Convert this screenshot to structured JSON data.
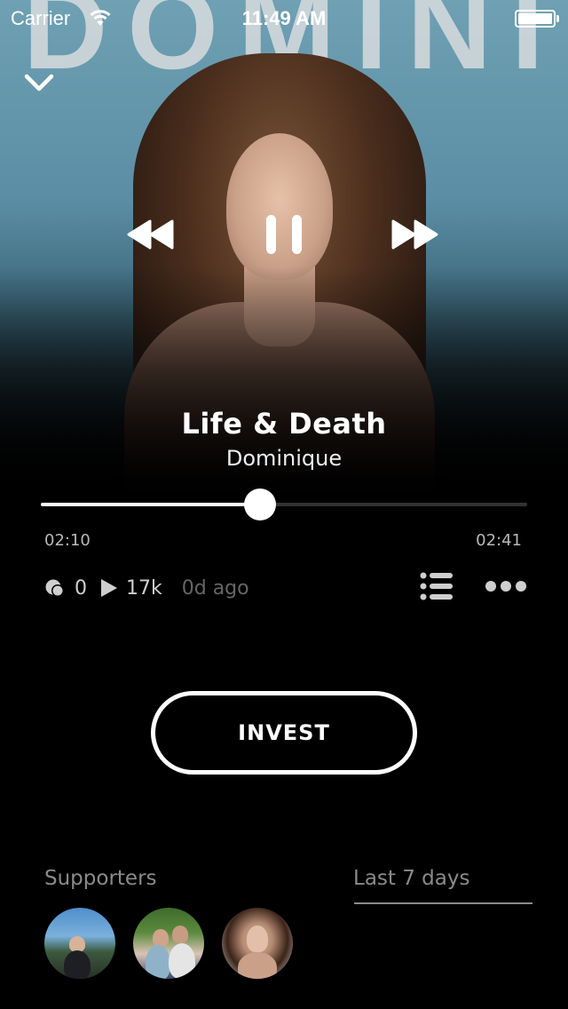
{
  "status_bar": {
    "carrier": "Carrier",
    "time": "11:49 AM"
  },
  "album_art": {
    "lettering": "DOMINIQUE"
  },
  "track": {
    "title": "Life & Death",
    "artist": "Dominique",
    "elapsed": "02:10",
    "duration": "02:41",
    "progress_fraction": 0.45
  },
  "stats": {
    "supporters_count": "0",
    "plays": "17k",
    "age": "0d ago"
  },
  "invest_button": {
    "label": "INVEST"
  },
  "supporters": {
    "label": "Supporters",
    "range": "Last 7 days",
    "avatars": [
      "supporter-1",
      "supporter-2",
      "supporter-3"
    ]
  },
  "colors": {
    "background": "#000000",
    "text": "#ffffff",
    "muted": "#8a8a8a"
  },
  "icons": [
    "chevron-down-icon",
    "rewind-icon",
    "pause-icon",
    "fast-forward-icon",
    "supporters-icon",
    "play-count-icon",
    "queue-list-icon",
    "more-icon",
    "wifi-icon",
    "battery-icon"
  ]
}
